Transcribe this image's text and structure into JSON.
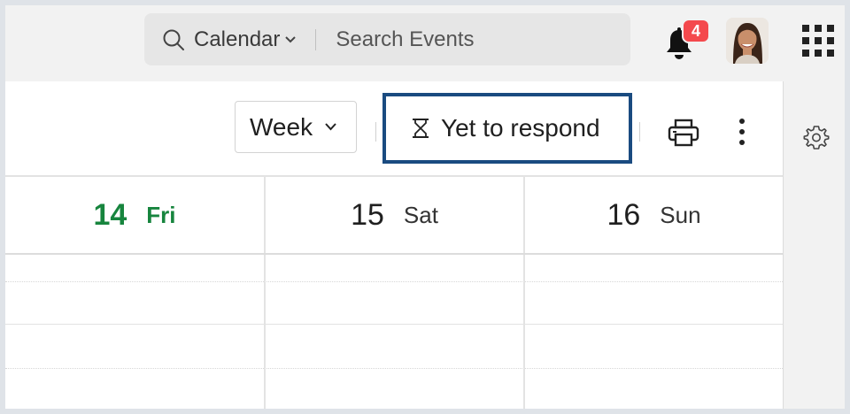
{
  "topbar": {
    "search": {
      "scope_label": "Calendar",
      "placeholder": "Search Events",
      "icon": "search-icon"
    },
    "notifications": {
      "count": "4",
      "icon": "bell-icon"
    },
    "avatar_icon": "user-avatar",
    "apps_icon": "grid-icon"
  },
  "toolbar": {
    "view_label": "Week",
    "filter_label": "Yet to respond",
    "filter_icon": "hourglass-icon",
    "print_icon": "printer-icon",
    "more_icon": "more-vertical-icon",
    "settings_icon": "gear-icon"
  },
  "calendar": {
    "days": [
      {
        "num": "14",
        "name": "Fri",
        "today": true
      },
      {
        "num": "15",
        "name": "Sat",
        "today": false
      },
      {
        "num": "16",
        "name": "Sun",
        "today": false
      }
    ]
  },
  "colors": {
    "today_green": "#17853e",
    "highlight_border": "#1a4b80",
    "badge_red": "#f4494d"
  }
}
